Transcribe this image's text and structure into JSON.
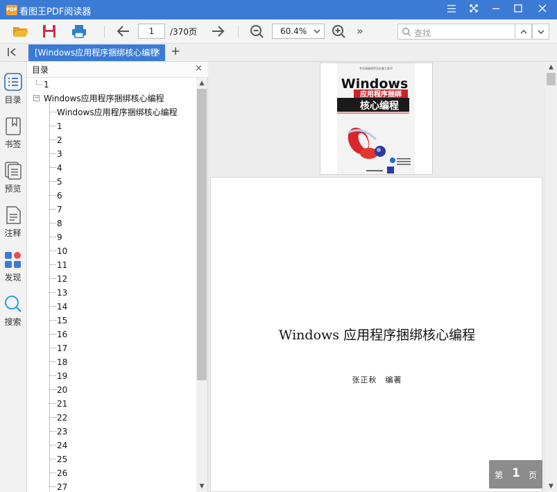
{
  "app": {
    "title": "看图王PDF阅读器",
    "logo_text": "PDF",
    "accent_color": "#3b7bd6"
  },
  "window_controls": [
    "menu-icon",
    "fullscreen-icon",
    "minimize-icon",
    "maximize-icon",
    "close-icon"
  ],
  "toolbar": {
    "open_icon": "folder-open-icon",
    "save_icon": "save-icon",
    "print_icon": "print-icon",
    "prev_icon": "arrow-left-icon",
    "page_current": "1",
    "page_total": "/370页",
    "next_icon": "arrow-right-icon",
    "zoom_out_icon": "zoom-out-icon",
    "zoom_value": "60.4%",
    "zoom_in_icon": "zoom-in-icon",
    "more": "»",
    "search_placeholder": "查找"
  },
  "tabs": {
    "active_label": "[Windows应用程序捆绑核心编程",
    "close": "×",
    "add": "+"
  },
  "sidebar": {
    "items": [
      {
        "label": "目录",
        "icon": "toc-icon"
      },
      {
        "label": "书签",
        "icon": "bookmark-icon"
      },
      {
        "label": "预览",
        "icon": "preview-icon"
      },
      {
        "label": "注释",
        "icon": "annotation-icon"
      },
      {
        "label": "发现",
        "icon": "discover-icon"
      },
      {
        "label": "搜索",
        "icon": "search-icon"
      }
    ]
  },
  "toc": {
    "title": "目录",
    "close": "×",
    "root_item": "1",
    "book_item": "Windows应用程序捆绑核心编程",
    "children": [
      "Windows应用程序捆绑核心编程",
      "1",
      "2",
      "3",
      "4",
      "5",
      "6",
      "7",
      "8",
      "9",
      "10",
      "11",
      "12",
      "13",
      "14",
      "15",
      "16",
      "17",
      "18",
      "19",
      "20",
      "21",
      "22",
      "23",
      "24",
      "25",
      "26",
      "27"
    ]
  },
  "document": {
    "cover": {
      "series_line": "专业高级程序员必备工具书",
      "title_en": "Windows",
      "title_band": "应用程序捆绑",
      "title_main": "核心编程"
    },
    "page_title": "Windows 应用程序捆绑核心编程",
    "page_author": "张正秋　编著",
    "indicator": {
      "prefix": "第",
      "number": "1",
      "suffix": "页"
    }
  }
}
